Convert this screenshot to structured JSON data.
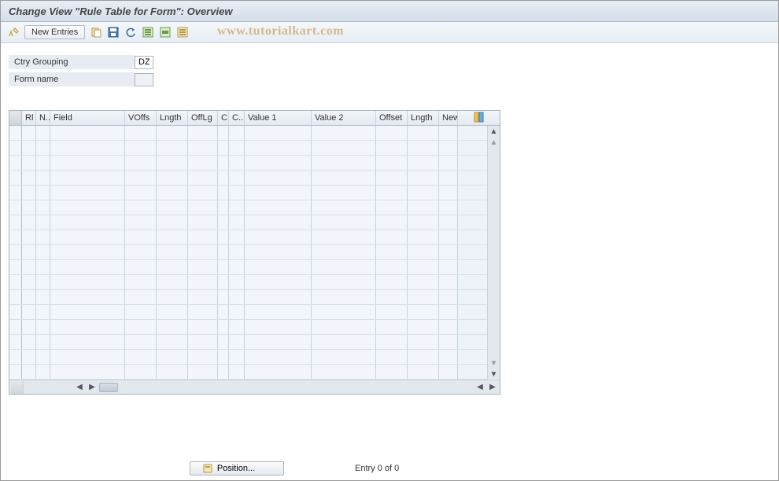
{
  "title": "Change View \"Rule Table for Form\": Overview",
  "toolbar": {
    "new_entries": "New Entries"
  },
  "watermark": "www.tutorialkart.com",
  "form": {
    "ctry_grouping_label": "Ctry Grouping",
    "ctry_grouping_value": "DZ",
    "form_name_label": "Form name",
    "form_name_value": ""
  },
  "table": {
    "columns": {
      "rl": "Rl",
      "n": "N..",
      "field": "Field",
      "voffs": "VOffs",
      "lngth": "Lngth",
      "offlg": "OffLg",
      "c1": "C",
      "c2": "C..",
      "value1": "Value 1",
      "value2": "Value 2",
      "offset": "Offset",
      "lngth2": "Lngth",
      "new": "New"
    },
    "row_count": 17
  },
  "footer": {
    "position_btn": "Position...",
    "entry_text": "Entry 0 of 0"
  }
}
